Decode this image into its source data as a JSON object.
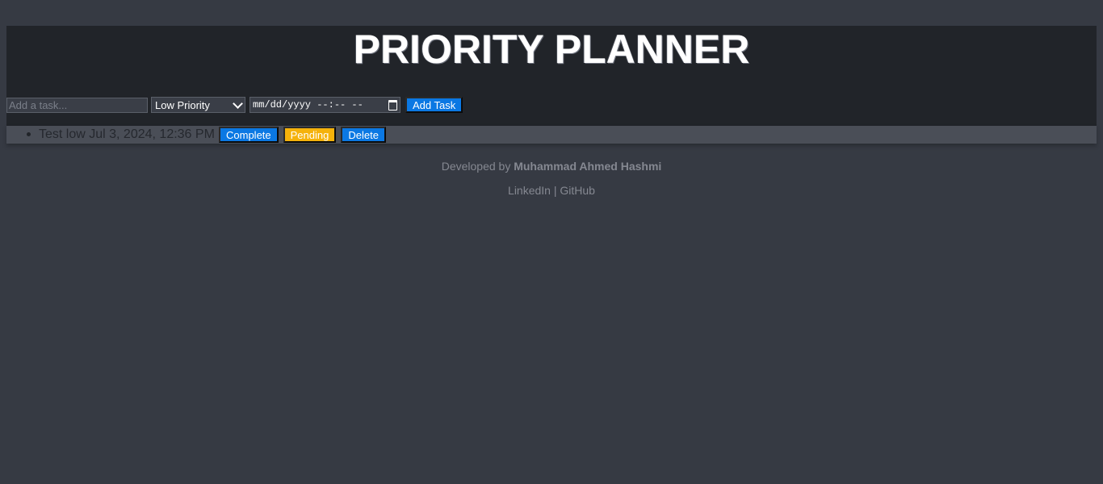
{
  "app": {
    "title": "PRIORITY PLANNER"
  },
  "form": {
    "task_placeholder": "Add a task...",
    "task_value": "",
    "priority_selected": "Low Priority",
    "date_placeholder": "mm/dd/yyyy --:-- --",
    "add_button_label": "Add Task"
  },
  "tasks": [
    {
      "text": "Test low Jul 3, 2024, 12:36 PM",
      "complete_label": "Complete",
      "pending_label": "Pending",
      "delete_label": "Delete"
    }
  ],
  "footer": {
    "developed_by_prefix": "Developed by ",
    "author": "Muhammad Ahmed Hashmi",
    "link_linkedin": "LinkedIn",
    "separator": " | ",
    "link_github": "GitHub"
  },
  "colors": {
    "page_bg": "#363a43",
    "panel_bg": "#212429",
    "row_bg": "#4a4e57",
    "button_blue": "#0b78e3",
    "button_yellow": "#f5b20b"
  },
  "icons": {
    "select_arrow": "chevron-down-icon",
    "date_picker": "calendar-icon"
  }
}
